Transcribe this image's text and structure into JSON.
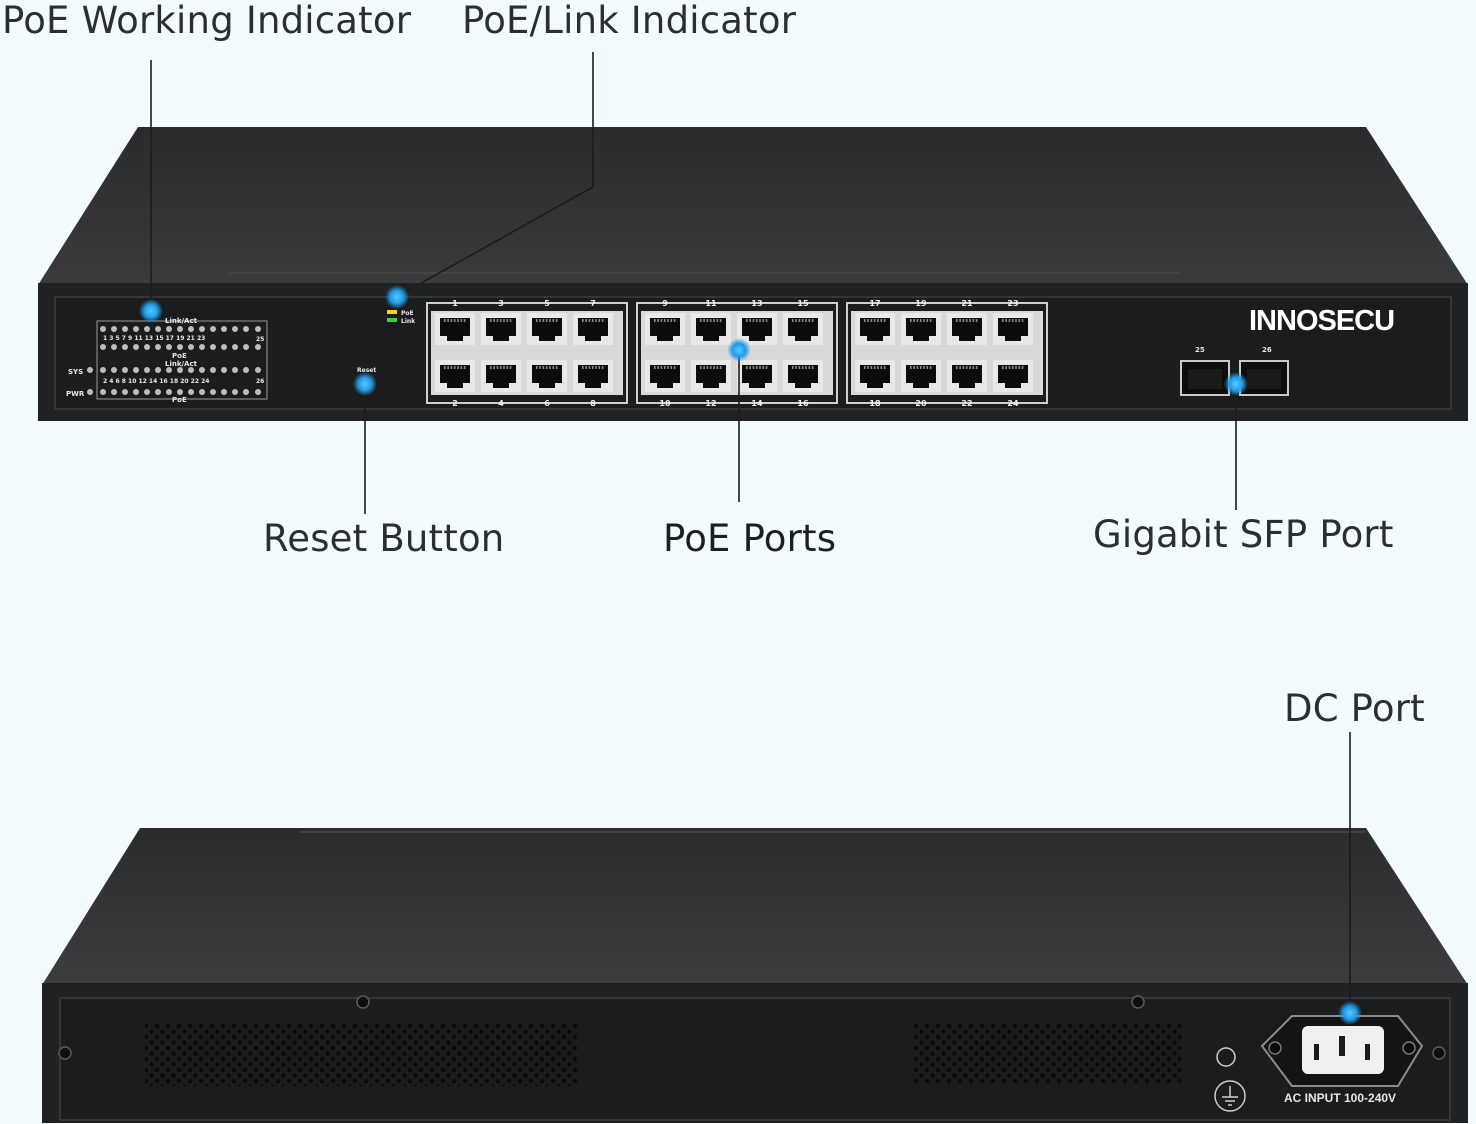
{
  "callouts": {
    "poe_working_indicator": "PoE Working Indicator",
    "poe_link_indicator": "PoE/Link Indicator",
    "reset_button": "Reset Button",
    "poe_ports": "PoE Ports",
    "gigabit_sfp_port": "Gigabit SFP Port",
    "dc_port": "DC Port"
  },
  "front_panel": {
    "brand": "INNOSECU",
    "led_labels": {
      "link_act": "Link/Act",
      "poe": "PoE",
      "link_act_2": "Link/Act",
      "poe_2": "PoE",
      "sys": "SYS",
      "pwr": "PWR",
      "led_top_numbers": "1  3  5  7  9  11  13  15  17  19  21  23",
      "led_bottom_numbers": "2  4  6  8  10  12  14  16  18  20  22  24",
      "port_25": "25",
      "port_26": "26"
    },
    "legend": {
      "poe": "PoE",
      "link": "Link"
    },
    "reset_label": "Reset",
    "port_numbers_top": [
      "1",
      "3",
      "5",
      "7",
      "9",
      "11",
      "13",
      "15",
      "17",
      "19",
      "21",
      "23"
    ],
    "port_numbers_bottom": [
      "2",
      "4",
      "6",
      "8",
      "10",
      "12",
      "14",
      "16",
      "18",
      "20",
      "22",
      "24"
    ],
    "sfp_labels": [
      "25",
      "26"
    ]
  },
  "back_panel": {
    "ac_input_label": "AC INPUT 100-240V"
  },
  "colors": {
    "background": "#f3fbff",
    "chassis": "#1f2021",
    "marker": "#2fa8ec",
    "label_text": "#2b2f33"
  }
}
